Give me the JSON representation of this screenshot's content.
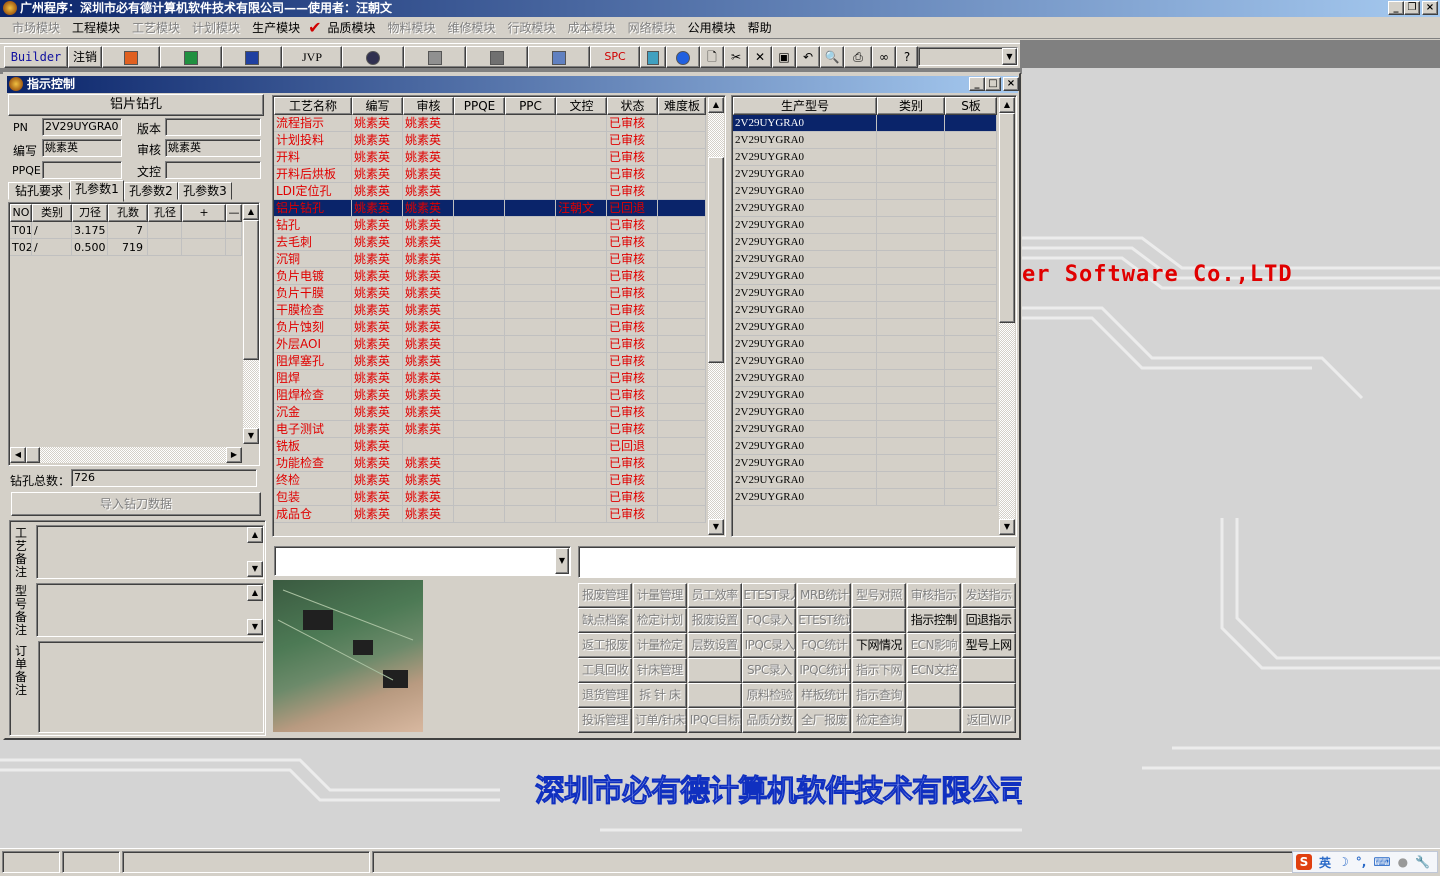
{
  "app_title": "广州程序：深圳市必有德计算机软件技术有限公司——使用者：汪朝文",
  "menu": [
    {
      "label": "市场模块",
      "enabled": false
    },
    {
      "label": "工程模块",
      "enabled": true
    },
    {
      "label": "工艺模块",
      "enabled": false
    },
    {
      "label": "计划模块",
      "enabled": false
    },
    {
      "label": "生产模块",
      "enabled": true
    },
    {
      "label": "品质模块",
      "enabled": true,
      "checked": true
    },
    {
      "label": "物料模块",
      "enabled": false
    },
    {
      "label": "维修模块",
      "enabled": false
    },
    {
      "label": "行政模块",
      "enabled": false
    },
    {
      "label": "成本模块",
      "enabled": false
    },
    {
      "label": "网络模块",
      "enabled": false
    },
    {
      "label": "公用模块",
      "enabled": true
    },
    {
      "label": "帮助",
      "enabled": true
    }
  ],
  "toolbar": {
    "builder": "Builder",
    "logout": "注销",
    "jvp": "JVP",
    "spc": "SPC",
    "combo_value": ""
  },
  "child": {
    "title": "指示控制"
  },
  "left": {
    "header": "铝片钻孔",
    "pn_label": "PN",
    "pn": "2V29UYGRA0",
    "version_label": "版本",
    "version": "",
    "writer_label": "编写",
    "writer": "姚素英",
    "reviewer_label": "审核",
    "reviewer": "姚素英",
    "ppqe_label": "PPQE",
    "ppqe": "",
    "doc_label": "文控",
    "doc": "",
    "tabs": [
      "钻孔要求",
      "孔参数1",
      "孔参数2",
      "孔参数3"
    ],
    "active_tab": 1,
    "drill_cols": [
      "NO",
      "类别",
      "刀径",
      "孔数",
      "孔径",
      "+",
      "—"
    ],
    "drill_rows": [
      [
        "T01",
        "/",
        "3.175",
        "7",
        ""
      ],
      [
        "T02",
        "/",
        "0.500",
        "719",
        ""
      ]
    ],
    "total_label": "钻孔总数：",
    "total": "726",
    "import_button": "导入钻刀数据",
    "notes": [
      "工艺备注",
      "型号备注",
      "订单备注"
    ]
  },
  "process": {
    "cols": [
      "工艺名称",
      "编写",
      "审核",
      "PPQE",
      "PPC",
      "文控",
      "状态",
      "难度板"
    ],
    "selected": 5,
    "rows": [
      [
        "流程指示",
        "姚素英",
        "姚素英",
        "",
        "",
        "",
        "已审核",
        ""
      ],
      [
        "计划投料",
        "姚素英",
        "姚素英",
        "",
        "",
        "",
        "已审核",
        ""
      ],
      [
        "开料",
        "姚素英",
        "姚素英",
        "",
        "",
        "",
        "已审核",
        ""
      ],
      [
        "开料后烘板",
        "姚素英",
        "姚素英",
        "",
        "",
        "",
        "已审核",
        ""
      ],
      [
        "LDI定位孔",
        "姚素英",
        "姚素英",
        "",
        "",
        "",
        "已审核",
        ""
      ],
      [
        "铝片钻孔",
        "姚素英",
        "姚素英",
        "",
        "",
        "汪朝文",
        "已回退",
        ""
      ],
      [
        "钻孔",
        "姚素英",
        "姚素英",
        "",
        "",
        "",
        "已审核",
        ""
      ],
      [
        "去毛刺",
        "姚素英",
        "姚素英",
        "",
        "",
        "",
        "已审核",
        ""
      ],
      [
        "沉铜",
        "姚素英",
        "姚素英",
        "",
        "",
        "",
        "已审核",
        ""
      ],
      [
        "负片电镀",
        "姚素英",
        "姚素英",
        "",
        "",
        "",
        "已审核",
        ""
      ],
      [
        "负片干膜",
        "姚素英",
        "姚素英",
        "",
        "",
        "",
        "已审核",
        ""
      ],
      [
        "干膜检查",
        "姚素英",
        "姚素英",
        "",
        "",
        "",
        "已审核",
        ""
      ],
      [
        "负片蚀刻",
        "姚素英",
        "姚素英",
        "",
        "",
        "",
        "已审核",
        ""
      ],
      [
        "外层AOI",
        "姚素英",
        "姚素英",
        "",
        "",
        "",
        "已审核",
        ""
      ],
      [
        "阻焊塞孔",
        "姚素英",
        "姚素英",
        "",
        "",
        "",
        "已审核",
        ""
      ],
      [
        "阻焊",
        "姚素英",
        "姚素英",
        "",
        "",
        "",
        "已审核",
        ""
      ],
      [
        "阻焊检查",
        "姚素英",
        "姚素英",
        "",
        "",
        "",
        "已审核",
        ""
      ],
      [
        "沉金",
        "姚素英",
        "姚素英",
        "",
        "",
        "",
        "已审核",
        ""
      ],
      [
        "电子测试",
        "姚素英",
        "姚素英",
        "",
        "",
        "",
        "已审核",
        ""
      ],
      [
        "铣板",
        "姚素英",
        "",
        "",
        "",
        "",
        "已回退",
        ""
      ],
      [
        "功能检查",
        "姚素英",
        "姚素英",
        "",
        "",
        "",
        "已审核",
        ""
      ],
      [
        "终检",
        "姚素英",
        "姚素英",
        "",
        "",
        "",
        "已审核",
        ""
      ],
      [
        "包装",
        "姚素英",
        "姚素英",
        "",
        "",
        "",
        "已审核",
        ""
      ],
      [
        "成品仓",
        "姚素英",
        "姚素英",
        "",
        "",
        "",
        "已审核",
        ""
      ]
    ]
  },
  "models": {
    "cols": [
      "生产型号",
      "类别",
      "S板"
    ],
    "selected": 0,
    "rows": [
      "2V29UYGRA0",
      "2V29UYGRA0",
      "2V29UYGRA0",
      "2V29UYGRA0",
      "2V29UYGRA0",
      "2V29UYGRA0",
      "2V29UYGRA0",
      "2V29UYGRA0",
      "2V29UYGRA0",
      "2V29UYGRA0",
      "2V29UYGRA0",
      "2V29UYGRA0",
      "2V29UYGRA0",
      "2V29UYGRA0",
      "2V29UYGRA0",
      "2V29UYGRA0",
      "2V29UYGRA0",
      "2V29UYGRA0",
      "2V29UYGRA0",
      "2V29UYGRA0",
      "2V29UYGRA0",
      "2V29UYGRA0",
      "2V29UYGRA0"
    ]
  },
  "buttons": [
    [
      [
        "报废管理",
        0
      ],
      [
        "计量管理",
        0
      ],
      [
        "员工效率",
        0
      ],
      [
        "ETEST录入",
        0
      ],
      [
        "MRB统计",
        0
      ],
      [
        "型号对照",
        0
      ],
      [
        "审核指示",
        0
      ],
      [
        "发送指示",
        0
      ]
    ],
    [
      [
        "缺点档案",
        0
      ],
      [
        "检定计划",
        0
      ],
      [
        "报废设置",
        0
      ],
      [
        "FQC录入",
        0
      ],
      [
        "ETEST统计",
        0
      ],
      [
        "",
        0
      ],
      [
        "指示控制",
        1
      ],
      [
        "回退指示",
        1
      ]
    ],
    [
      [
        "返工报废",
        0
      ],
      [
        "计量检定",
        0
      ],
      [
        "层数设置",
        0
      ],
      [
        "IPQC录入",
        0
      ],
      [
        "FQC统计",
        0
      ],
      [
        "下网情况",
        1
      ],
      [
        "ECN影响",
        0
      ],
      [
        "型号上网",
        1
      ]
    ],
    [
      [
        "工具回收",
        0
      ],
      [
        "针床管理",
        0
      ],
      [
        "",
        0
      ],
      [
        "SPC录入",
        0
      ],
      [
        "IPQC统计",
        0
      ],
      [
        "指示下网",
        0
      ],
      [
        "ECN文控",
        0
      ],
      [
        "",
        0
      ]
    ],
    [
      [
        "退货管理",
        0
      ],
      [
        "拆 针 床",
        0
      ],
      [
        "",
        0
      ],
      [
        "原料检验",
        0
      ],
      [
        "样板统计",
        0
      ],
      [
        "指示查询",
        0
      ],
      [
        "",
        0
      ],
      [
        "",
        0
      ]
    ],
    [
      [
        "投诉管理",
        0
      ],
      [
        "订单/针床",
        0
      ],
      [
        "IPQC目标",
        0
      ],
      [
        "品质分数",
        0
      ],
      [
        "全厂报废",
        0
      ],
      [
        "检定查询",
        0
      ],
      [
        "",
        0
      ],
      [
        "返回WIP",
        0
      ]
    ]
  ],
  "desktop": {
    "company_en": "er Software Co.,LTD",
    "company_cn": "深圳市必有德计算机软件技术有限公司"
  },
  "tray": {
    "ime": "英"
  },
  "colors": {
    "title": "#0a246a",
    "selection": "#0a246a",
    "text_red": "#e00000",
    "company_blue": "#2040d0"
  }
}
